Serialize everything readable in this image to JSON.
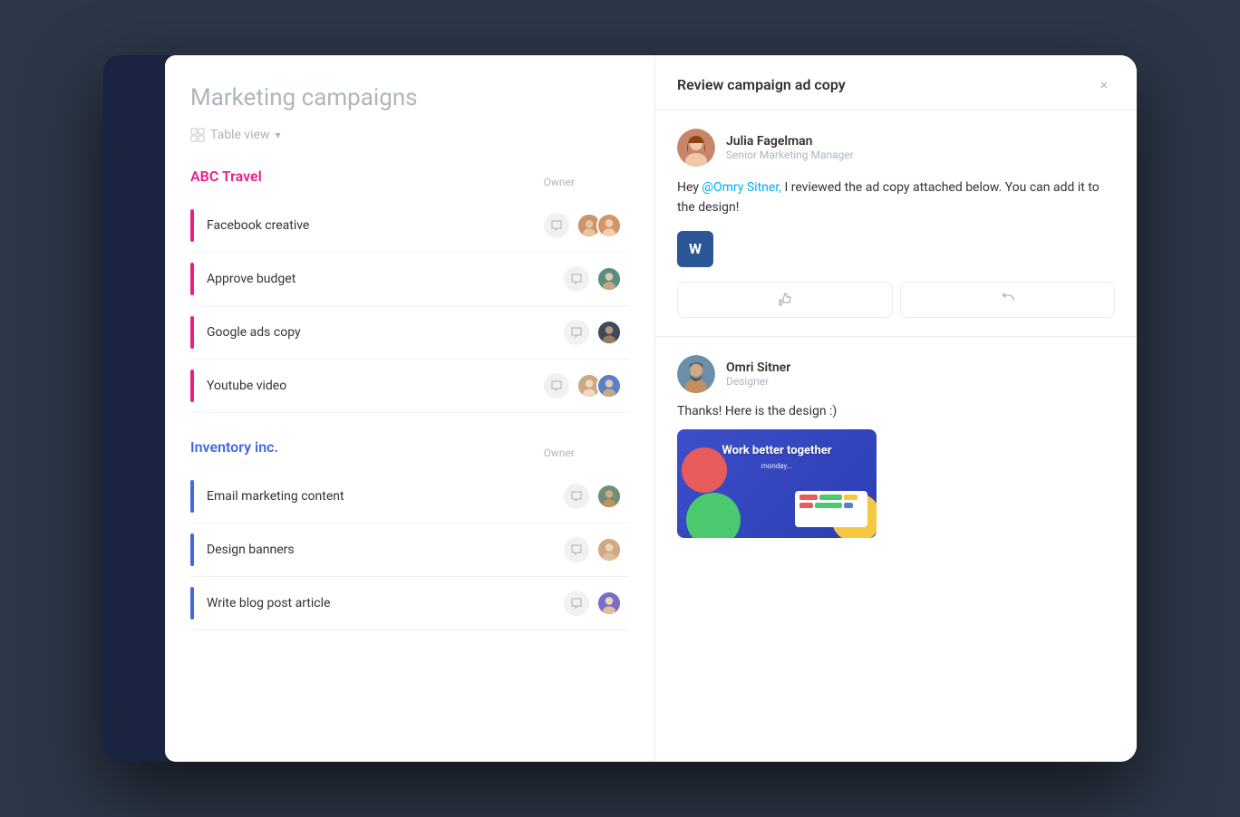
{
  "page": {
    "title": "Marketing campaigns",
    "view": {
      "label": "Table view",
      "chevron": "▾"
    },
    "close_btn": "×"
  },
  "groups": [
    {
      "id": "abc-travel",
      "name": "ABC Travel",
      "color": "pink",
      "owner_label": "Owner",
      "tasks": [
        {
          "id": "t1",
          "name": "Facebook creative",
          "color": "pink",
          "avatars": [
            "av-brown",
            "av-coral"
          ]
        },
        {
          "id": "t2",
          "name": "Approve budget",
          "color": "pink",
          "avatars": [
            "av-teal"
          ]
        },
        {
          "id": "t3",
          "name": "Google ads copy",
          "color": "pink",
          "avatars": [
            "av-dark"
          ]
        },
        {
          "id": "t4",
          "name": "Youtube video",
          "color": "pink",
          "avatars": [
            "av-beige",
            "av-blue"
          ]
        }
      ]
    },
    {
      "id": "inventory-inc",
      "name": "Inventory inc.",
      "color": "blue",
      "owner_label": "Owner",
      "tasks": [
        {
          "id": "t5",
          "name": "Email marketing content",
          "color": "blue",
          "avatars": [
            "av-green"
          ]
        },
        {
          "id": "t6",
          "name": "Design banners",
          "color": "blue",
          "avatars": [
            "av-orange"
          ]
        },
        {
          "id": "t7",
          "name": "Write blog post article",
          "color": "blue",
          "avatars": [
            "av-purple"
          ]
        }
      ]
    }
  ],
  "modal": {
    "title": "Review campaign ad copy",
    "comment1": {
      "user_name": "Julia Fagelman",
      "user_title": "Senior Marketing Manager",
      "text_before": "Hey ",
      "mention": "@Omry Sitner,",
      "text_after": " I reviewed the ad copy attached below. You can add it to the design!",
      "doc_label": "W",
      "like_icon": "👍",
      "reply_icon": "↩"
    },
    "comment2": {
      "user_name": "Omri Sitner",
      "user_title": "Designer",
      "text": "Thanks! Here is the design :)",
      "preview": {
        "headline": "Work better together",
        "logo": "monday..."
      }
    }
  }
}
